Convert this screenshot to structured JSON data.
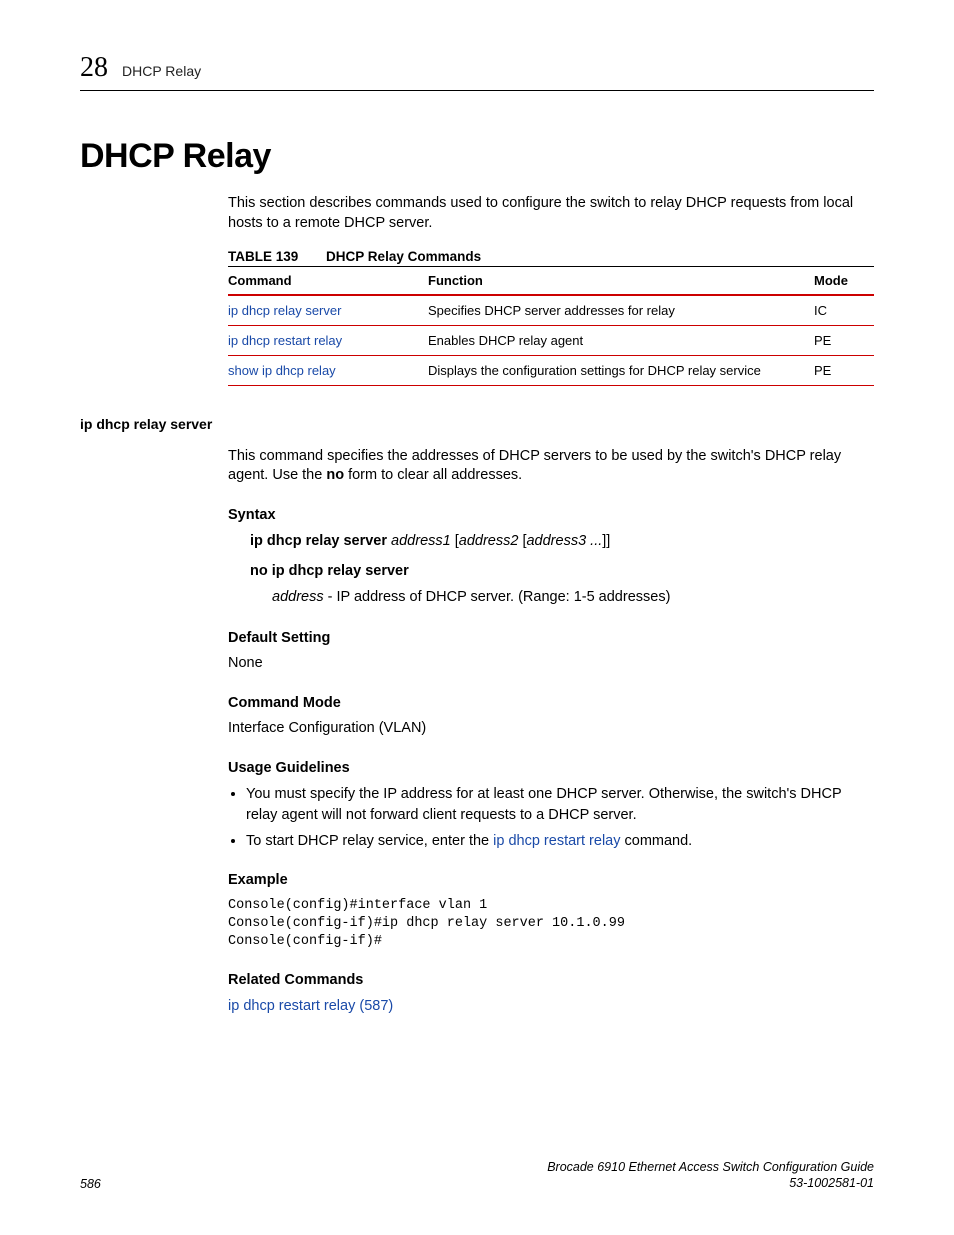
{
  "header": {
    "chapter_number": "28",
    "chapter_title": "DHCP Relay"
  },
  "section": {
    "title": "DHCP Relay",
    "intro": "This section describes commands used to configure the switch to relay DHCP requests from local hosts to a remote DHCP server."
  },
  "table": {
    "label": "TABLE 139",
    "title": "DHCP Relay Commands",
    "headers": {
      "command": "Command",
      "function": "Function",
      "mode": "Mode"
    },
    "rows": [
      {
        "command": "ip dhcp relay server",
        "function": "Specifies DHCP server addresses for relay",
        "mode": "IC"
      },
      {
        "command": "ip dhcp restart relay",
        "function": "Enables DHCP relay agent",
        "mode": "PE"
      },
      {
        "command": "show ip dhcp relay",
        "function": "Displays the configuration settings for DHCP relay service",
        "mode": "PE"
      }
    ]
  },
  "cmd": {
    "name": "ip dhcp relay server",
    "desc_pre": "This command specifies the addresses of DHCP servers to be used by the switch's DHCP relay agent. Use the ",
    "desc_bold": "no",
    "desc_post": " form to clear all addresses.",
    "syntax_head": "Syntax",
    "syntax1_bold": "ip dhcp relay server ",
    "syntax1_it1": "address1",
    "syntax1_mid1": " [",
    "syntax1_it2": "address2",
    "syntax1_mid2": " [",
    "syntax1_it3": "address3 ...",
    "syntax1_end": "]]",
    "syntax2": "no ip dhcp relay server",
    "syntax_param_it": "address",
    "syntax_param_rest": " - IP address of DHCP server. (Range: 1-5 addresses)",
    "default_head": "Default Setting",
    "default_val": "None",
    "mode_head": "Command Mode",
    "mode_val": "Interface Configuration (VLAN)",
    "usage_head": "Usage Guidelines",
    "usage1": "You must specify the IP address for at least one DHCP server. Otherwise, the switch's DHCP relay agent will not forward client requests to a DHCP server.",
    "usage2_pre": "To start DHCP relay service, enter the ",
    "usage2_link": "ip dhcp restart relay",
    "usage2_post": " command.",
    "example_head": "Example",
    "example_code": "Console(config)#interface vlan 1\nConsole(config-if)#ip dhcp relay server 10.1.0.99\nConsole(config-if)#",
    "related_head": "Related Commands",
    "related_link": "ip dhcp restart relay (587)"
  },
  "footer": {
    "page": "586",
    "doc_title": "Brocade 6910 Ethernet Access Switch Configuration Guide",
    "doc_id": "53-1002581-01"
  }
}
